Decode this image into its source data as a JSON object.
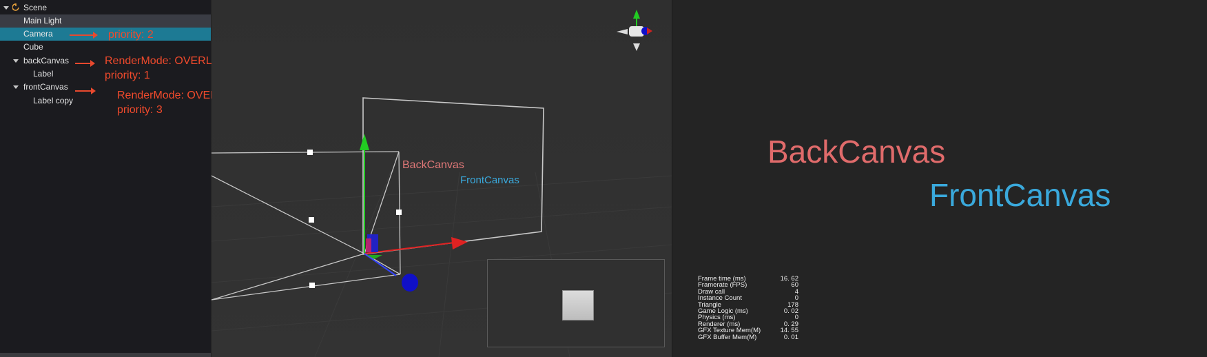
{
  "hierarchy": {
    "nodes": [
      {
        "label": "Scene"
      },
      {
        "label": "Main Light"
      },
      {
        "label": "Camera"
      },
      {
        "label": "Cube"
      },
      {
        "label": "backCanvas"
      },
      {
        "label": "Label"
      },
      {
        "label": "frontCanvas"
      },
      {
        "label": "Label copy"
      }
    ]
  },
  "annotations": {
    "camera": "priority: 2",
    "back_line1": "RenderMode: OVERLAY",
    "back_line2": "priority: 1",
    "front_line1": "RenderMode: OVERLAY",
    "front_line2": "priority: 3"
  },
  "scene_view": {
    "back_label": "BackCanvas",
    "front_label": "FrontCanvas"
  },
  "game_view": {
    "back_label": "BackCanvas",
    "front_label": "FrontCanvas",
    "stats": [
      {
        "label": "Frame time (ms)",
        "value": "16. 62"
      },
      {
        "label": "Framerate (FPS)",
        "value": "60"
      },
      {
        "label": "Draw call",
        "value": "4"
      },
      {
        "label": "Instance Count",
        "value": "0"
      },
      {
        "label": "Triangle",
        "value": "178"
      },
      {
        "label": "Game Logic (ms)",
        "value": "0. 02"
      },
      {
        "label": "Physics (ms)",
        "value": "0"
      },
      {
        "label": "Renderer (ms)",
        "value": "0. 29"
      },
      {
        "label": "GFX Texture Mem(M)",
        "value": "14. 55"
      },
      {
        "label": "GFX Buffer Mem(M)",
        "value": "0. 01"
      }
    ]
  },
  "colors": {
    "annotation": "#f04a2c",
    "selected_row": "#1d7a94",
    "back_label": "#e06b6b",
    "front_label": "#3aa9dc"
  }
}
